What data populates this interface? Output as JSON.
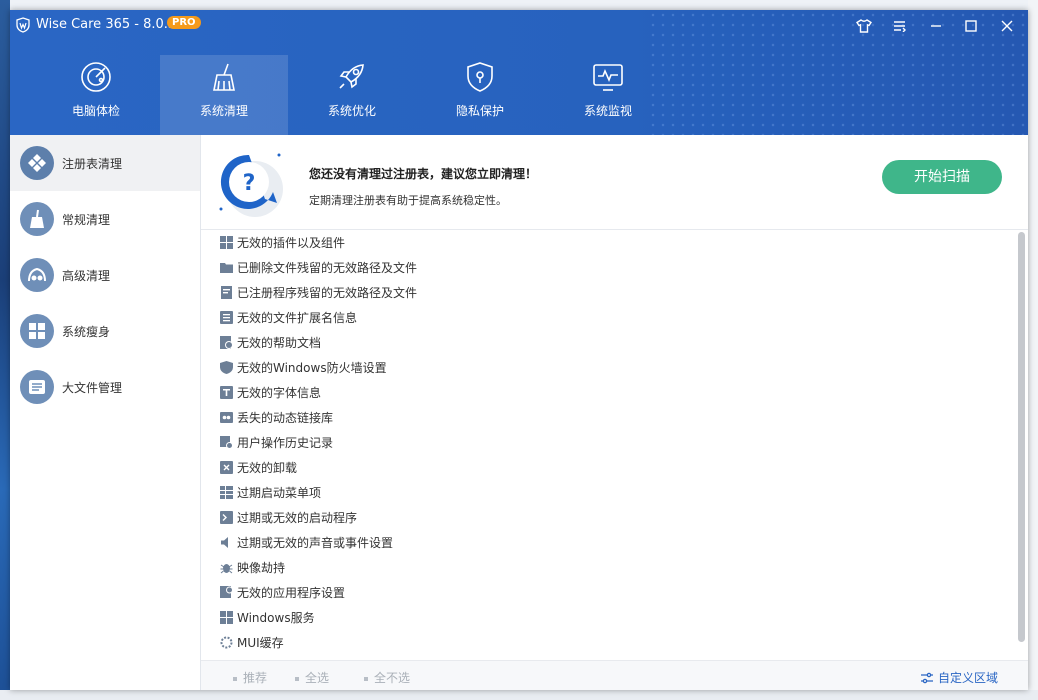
{
  "window": {
    "title": "Wise Care 365 - 8.0.5",
    "badge": "PRO",
    "accent_color": "#2a66c4",
    "controls": [
      "shirt-icon",
      "menu-icon",
      "minimize-icon",
      "maximize-icon",
      "close-icon"
    ]
  },
  "nav": {
    "items": [
      {
        "label": "电脑体检",
        "icon": "radar-icon"
      },
      {
        "label": "系统清理",
        "icon": "broom-icon",
        "active": true
      },
      {
        "label": "系统优化",
        "icon": "rocket-icon"
      },
      {
        "label": "隐私保护",
        "icon": "shield-lock-icon"
      },
      {
        "label": "系统监视",
        "icon": "monitor-icon"
      }
    ]
  },
  "sidebar": {
    "items": [
      {
        "label": "注册表清理",
        "icon": "registry-icon",
        "active": true
      },
      {
        "label": "常规清理",
        "icon": "broom-icon"
      },
      {
        "label": "高级清理",
        "icon": "advanced-clean-icon"
      },
      {
        "label": "系统瘦身",
        "icon": "windows-icon"
      },
      {
        "label": "大文件管理",
        "icon": "file-list-icon"
      }
    ]
  },
  "banner": {
    "title": "您还没有清理过注册表，建议您立即清理！",
    "subtitle": "定期清理注册表有助于提高系统稳定性。",
    "scan_button": "开始扫描",
    "scan_color": "#3fb68a"
  },
  "list": {
    "items": [
      {
        "label": "无效的插件以及组件",
        "checked": true
      },
      {
        "label": "已删除文件残留的无效路径及文件",
        "checked": true
      },
      {
        "label": "已注册程序残留的无效路径及文件",
        "checked": true
      },
      {
        "label": "无效的文件扩展名信息",
        "checked": true
      },
      {
        "label": "无效的帮助文档",
        "checked": true
      },
      {
        "label": "无效的Windows防火墙设置",
        "checked": true
      },
      {
        "label": "无效的字体信息",
        "checked": true
      },
      {
        "label": "丢失的动态链接库",
        "checked": true
      },
      {
        "label": "用户操作历史记录",
        "checked": true
      },
      {
        "label": "无效的卸载",
        "checked": true
      },
      {
        "label": "过期启动菜单项",
        "checked": true
      },
      {
        "label": "过期或无效的启动程序",
        "checked": true
      },
      {
        "label": "过期或无效的声音或事件设置",
        "checked": true
      },
      {
        "label": "映像劫持",
        "checked": true
      },
      {
        "label": "无效的应用程序设置",
        "checked": true
      },
      {
        "label": "Windows服务",
        "checked": true
      },
      {
        "label": "MUI缓存",
        "checked": true
      }
    ]
  },
  "footer": {
    "recommend": "推荐",
    "select_all": "全选",
    "select_none": "全不选",
    "custom_area": "自定义区域"
  }
}
